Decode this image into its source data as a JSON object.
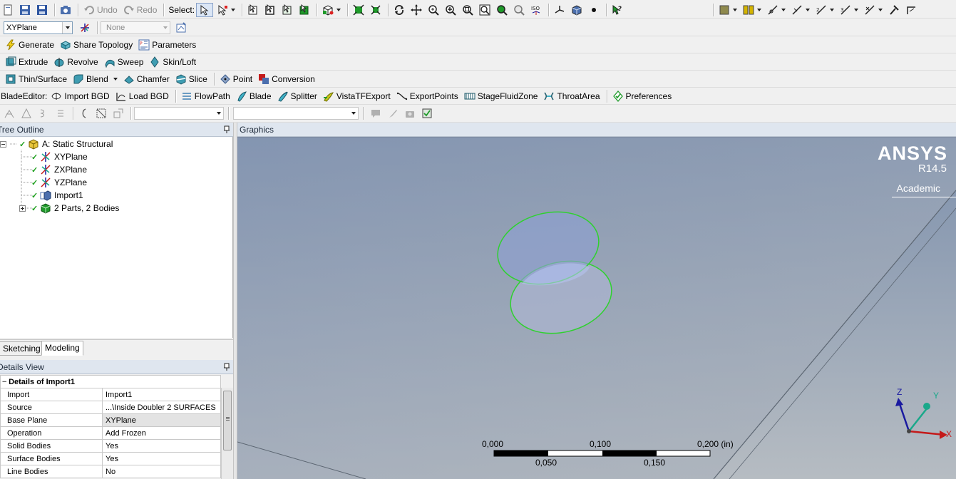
{
  "toolbar1": {
    "undo_label": "Undo",
    "redo_label": "Redo",
    "select_label": "Select:"
  },
  "toolbar2": {
    "plane_select_value": "XYPlane",
    "sketch_select_value": "None"
  },
  "toolbar3": {
    "generate_label": "Generate",
    "share_topology_label": "Share Topology",
    "parameters_label": "Parameters"
  },
  "toolbar4": {
    "extrude_label": "Extrude",
    "revolve_label": "Revolve",
    "sweep_label": "Sweep",
    "skin_loft_label": "Skin/Loft"
  },
  "toolbar5": {
    "thin_surface_label": "Thin/Surface",
    "blend_label": "Blend",
    "chamfer_label": "Chamfer",
    "slice_label": "Slice",
    "point_label": "Point",
    "conversion_label": "Conversion"
  },
  "toolbar6": {
    "blade_editor_label": "BladeEditor:",
    "import_bgd_label": "Import BGD",
    "load_bgd_label": "Load BGD",
    "flowpath_label": "FlowPath",
    "blade_label": "Blade",
    "splitter_label": "Splitter",
    "vistatf_export_label": "VistaTFExport",
    "export_points_label": "ExportPoints",
    "stage_fluid_zone_label": "StageFluidZone",
    "throat_area_label": "ThroatArea",
    "preferences_label": "Preferences"
  },
  "tree_outline": {
    "title": "Tree Outline",
    "items": [
      {
        "label": "A: Static Structural"
      },
      {
        "label": "XYPlane"
      },
      {
        "label": "ZXPlane"
      },
      {
        "label": "YZPlane"
      },
      {
        "label": "Import1"
      },
      {
        "label": "2 Parts, 2 Bodies"
      }
    ]
  },
  "bottom_tabs": {
    "sketching_label": "Sketching",
    "modeling_label": "Modeling",
    "active": "Modeling"
  },
  "details_view": {
    "title": "Details View",
    "section_title": "Details of Import1",
    "rows": [
      {
        "property": "Import",
        "value": "Import1"
      },
      {
        "property": "Source",
        "value": "...\\Inside Doubler 2 SURFACES"
      },
      {
        "property": "Base Plane",
        "value": "XYPlane"
      },
      {
        "property": "Operation",
        "value": "Add Frozen"
      },
      {
        "property": "Solid Bodies",
        "value": "Yes"
      },
      {
        "property": "Surface Bodies",
        "value": "Yes"
      },
      {
        "property": "Line Bodies",
        "value": "No"
      }
    ]
  },
  "graphics": {
    "title": "Graphics",
    "brand": "ANSYS",
    "version": "R14.5",
    "edition": "Academic",
    "scale_top_labels": [
      "0,000",
      "0,100",
      "0,200 (in)"
    ],
    "scale_bottom_labels": [
      "0,050",
      "0,150"
    ],
    "axis_labels": {
      "x": "X",
      "y": "Y",
      "z": "Z"
    }
  },
  "colors": {
    "viewport_top": "#7e91ad",
    "viewport_bottom": "#b6bcc2",
    "selection_green": "#2fd12f",
    "axis_x": "#c41a1a",
    "axis_y": "#1aa88a",
    "axis_z": "#1a1aa0"
  }
}
